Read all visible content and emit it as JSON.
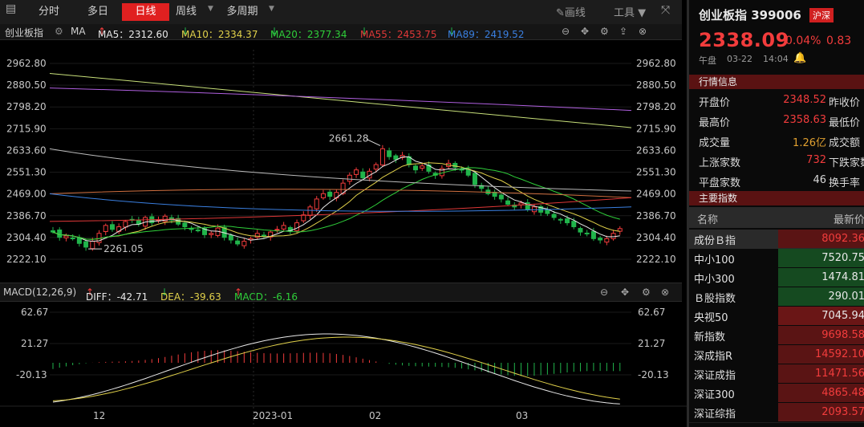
{
  "toolbar": {
    "periods": [
      "分时",
      "多日",
      "日线",
      "周线",
      "多周期"
    ],
    "active_period": "日线",
    "draw_label": "画线",
    "tools_label": "工具"
  },
  "ma_bar": {
    "name": "创业板指",
    "ma_label": "MA",
    "ma5": "MA5：2312.60",
    "ma10": "MA10：2334.37",
    "ma20": "MA20：2377.34",
    "ma55": "MA55：2453.75",
    "ma89": "MA89：2419.52",
    "arrow_up": "↑",
    "arrow_down": "↓"
  },
  "macd_bar": {
    "name": "MACD(12,26,9)",
    "diff": "DIFF：-42.71",
    "dea": "DEA：-39.63",
    "macd": "MACD：-6.16",
    "arrow_up": "↑",
    "arrow_down": "↓"
  },
  "price_axis": [
    "2962.80",
    "2880.50",
    "2798.20",
    "2715.90",
    "2633.60",
    "2551.30",
    "2469.00",
    "2386.70",
    "2304.40",
    "2222.10"
  ],
  "macd_axis": [
    "62.67",
    "21.27",
    "-20.13"
  ],
  "x_labels": [
    "12",
    "2023-01",
    "02",
    "03"
  ],
  "annotations": {
    "high": "2661.28",
    "low": "2261.05"
  },
  "colors": {
    "up": "#f23c3c",
    "down": "#21b44b",
    "ma5": "#e8e8e8",
    "ma10": "#e0d04a",
    "ma20": "#2fcf3a",
    "ma55": "#e03838",
    "ma89": "#3a7fe0"
  },
  "quote": {
    "title": "创业板指  399006",
    "exchange_badge": "沪深",
    "price": "2338.09",
    "change_pct": "0.04%",
    "change": "0.83",
    "session": "午盘",
    "date": "03-22",
    "time": "14:04"
  },
  "market_info": {
    "header": "行情信息",
    "rows": [
      {
        "label": "开盘价",
        "value": "2348.52",
        "label2": "昨收价",
        "color": "#f23c3c"
      },
      {
        "label": "最高价",
        "value": "2358.63",
        "label2": "最低价",
        "color": "#f23c3c"
      },
      {
        "label": "成交量",
        "value": "1.26亿",
        "label2": "成交额",
        "color": "#e0a030"
      },
      {
        "label": "上涨家数",
        "value": "732",
        "label2": "下跌家数",
        "color": "#f23c3c"
      },
      {
        "label": "平盘家数",
        "value": "46",
        "label2": "换手率",
        "color": "#d8d8d8"
      }
    ]
  },
  "main_indices": {
    "header": "主要指数",
    "col_name": "名称",
    "col_price": "最新价",
    "rows": [
      {
        "name": "成份Ｂ指",
        "price": "8092.36",
        "dir": "up"
      },
      {
        "name": "中小100",
        "price": "7520.75",
        "dir": "down"
      },
      {
        "name": "中小300",
        "price": "1474.81",
        "dir": "down"
      },
      {
        "name": "Ｂ股指数",
        "price": "290.01",
        "dir": "down"
      },
      {
        "name": "央视50",
        "price": "7045.94",
        "dir": "up"
      },
      {
        "name": "新指数",
        "price": "9698.58",
        "dir": "up"
      },
      {
        "name": "深成指R",
        "price": "14592.10",
        "dir": "up"
      },
      {
        "name": "深证成指",
        "price": "11471.56",
        "dir": "up"
      },
      {
        "name": "深证300",
        "price": "4865.48",
        "dir": "up"
      },
      {
        "name": "深证综指",
        "price": "2093.57",
        "dir": "up"
      }
    ]
  }
}
